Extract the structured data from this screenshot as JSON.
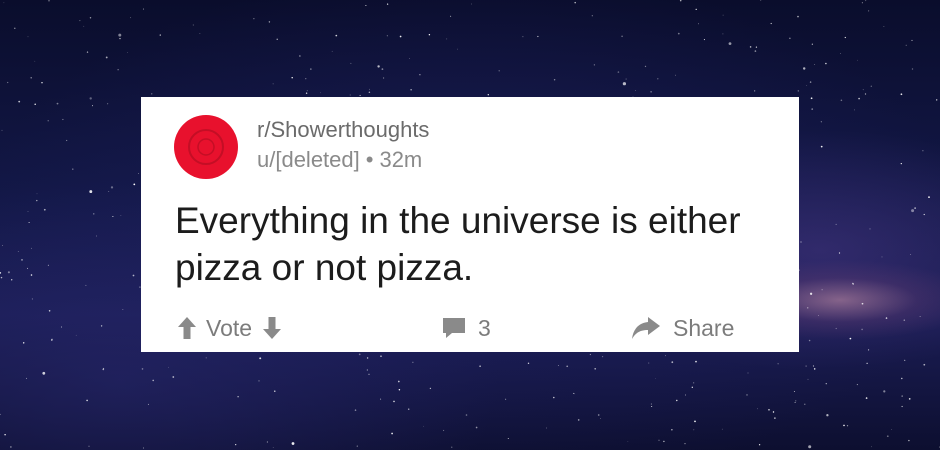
{
  "post": {
    "subreddit": "r/Showerthoughts",
    "author": "u/[deleted]",
    "separator": "•",
    "age": "32m",
    "title": "Everything in the universe is either pizza or not pizza."
  },
  "actions": {
    "vote_label": "Vote",
    "comment_count": "3",
    "share_label": "Share"
  },
  "icons": {
    "upvote": "upvote-arrow-icon",
    "downvote": "downvote-arrow-icon",
    "comment": "comment-bubble-icon",
    "share": "share-arrow-icon"
  },
  "colors": {
    "avatar": "#e8112d",
    "card": "#ffffff",
    "muted_text": "#7c7c7c",
    "title_text": "#1c1c1c"
  }
}
